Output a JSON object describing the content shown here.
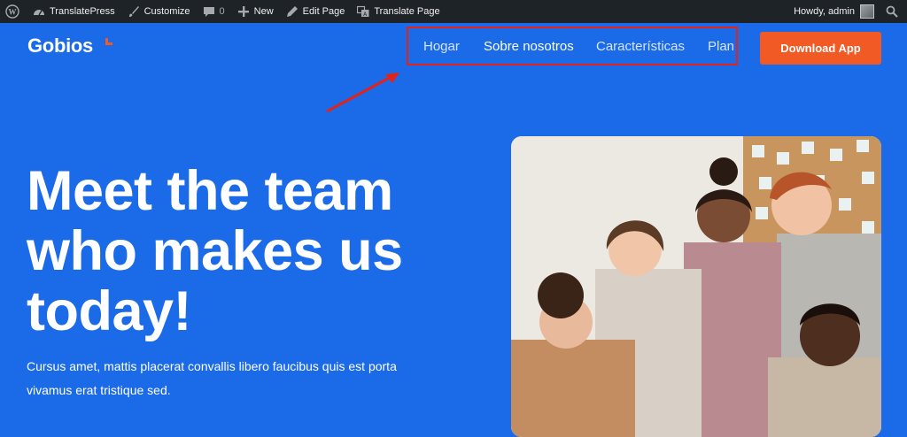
{
  "adminbar": {
    "wp_icon": "wordpress-icon",
    "items": [
      {
        "label": "TranslatePress",
        "icon": "dashboard-icon"
      },
      {
        "label": "Customize",
        "icon": "brush-icon"
      },
      {
        "label": "0",
        "icon": "comment-icon"
      },
      {
        "label": "New",
        "icon": "plus-icon"
      },
      {
        "label": "Edit Page",
        "icon": "pencil-icon"
      },
      {
        "label": "Translate Page",
        "icon": "translate-icon"
      }
    ],
    "greeting": "Howdy, admin",
    "search_icon": "search-icon"
  },
  "header": {
    "logo": "Gobios",
    "nav": [
      {
        "label": "Hogar"
      },
      {
        "label": "Sobre nosotros"
      },
      {
        "label": "Características"
      },
      {
        "label": "Plan"
      }
    ],
    "cta": "Download App"
  },
  "hero": {
    "title_lines": [
      "Meet the team",
      "who makes us",
      "today!"
    ],
    "text_lines": [
      "Cursus amet, mattis placerat convallis libero faucibus quis est porta",
      "vivamus erat tristique sed."
    ]
  },
  "colors": {
    "background": "#1b6be8",
    "adminbar": "#1d2327",
    "cta": "#f15a24",
    "highlight": "#e2231a"
  }
}
